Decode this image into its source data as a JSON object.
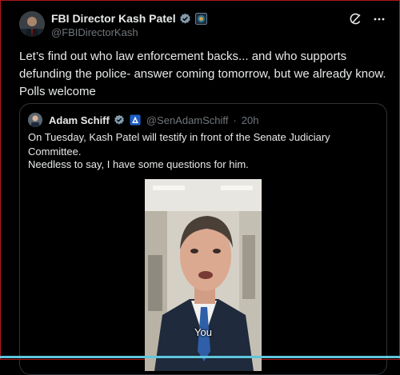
{
  "post": {
    "author_name": "FBI Director Kash Patel",
    "author_handle": "@FBIDirectorKash",
    "text": "Let’s find out who law enforcement backs... and who supports defunding the police- answer coming tomorrow, but we already know. Polls welcome",
    "icons": [
      "verified-badge-icon",
      "affiliate-seal-icon",
      "grok-icon",
      "more-options-icon"
    ],
    "colors": {
      "verified_badge": "#829aab",
      "text": "#e7e9ea",
      "muted": "#71767b"
    }
  },
  "quote": {
    "author_name": "Adam Schiff",
    "author_handle": "@SenAdamSchiff",
    "separator": "·",
    "time": "20h",
    "line1": "On Tuesday, Kash Patel will testify in front of the Senate Judiciary Committee.",
    "line2": "Needless to say, I have some questions for him.",
    "icons": [
      "verified-badge-icon",
      "government-badge-icon"
    ],
    "video": {
      "caption": "You"
    }
  }
}
